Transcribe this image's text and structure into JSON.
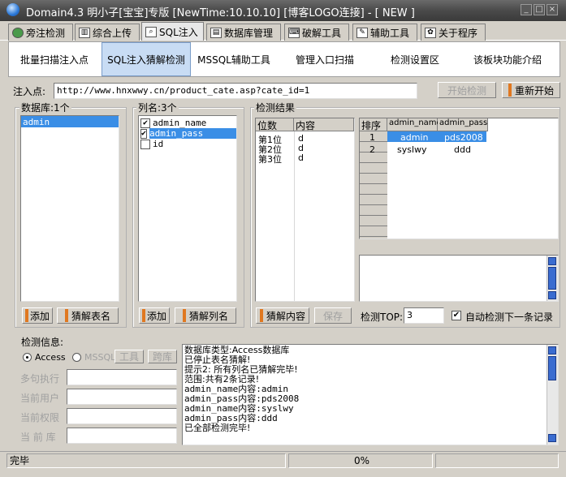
{
  "window": {
    "title": "Domain4.3 明小子[宝宝]专版 [NewTime:10.10.10] [博客LOGO连接]  - [ NEW ]",
    "controls": [
      "_",
      "□",
      "×"
    ]
  },
  "tabs": [
    {
      "label": "旁注检测",
      "icon": "globe-icon",
      "active": false
    },
    {
      "label": "综合上传",
      "icon": "chart-icon",
      "active": false
    },
    {
      "label": "SQL注入",
      "icon": "magnifier-icon",
      "active": true
    },
    {
      "label": "数据库管理",
      "icon": "database-icon",
      "active": false
    },
    {
      "label": "破解工具",
      "icon": "keyboard-icon",
      "active": false
    },
    {
      "label": "辅助工具",
      "icon": "pencil-icon",
      "active": false
    },
    {
      "label": "关于程序",
      "icon": "gift-icon",
      "active": false
    }
  ],
  "subtabs": [
    {
      "label": "批量扫描注入点",
      "active": false
    },
    {
      "label": "SQL注入猜解检测",
      "active": true
    },
    {
      "label": "MSSQL辅助工具",
      "active": false
    },
    {
      "label": "管理入口扫描",
      "active": false
    },
    {
      "label": "检测设置区",
      "active": false
    },
    {
      "label": "该板块功能介绍",
      "active": false
    }
  ],
  "inject": {
    "label": "注入点:",
    "url": "http://www.hnxwwy.cn/product_cate.asp?cate_id=1",
    "start_button": "开始检测",
    "restart_button": "重新开始"
  },
  "database": {
    "label": "数据库:1个",
    "items": [
      "admin"
    ],
    "add_button": "添加",
    "guess_button": "猜解表名"
  },
  "columns": {
    "label": "列名:3个",
    "items": [
      {
        "name": "admin_name",
        "checked": true,
        "selected": false
      },
      {
        "name": "admin_pass",
        "checked": true,
        "selected": true
      },
      {
        "name": "id",
        "checked": false,
        "selected": false
      }
    ],
    "add_button": "添加",
    "guess_button": "猜解列名"
  },
  "result": {
    "label": "检测结果",
    "pos_headers": [
      "位数",
      "内容"
    ],
    "pos_rows": [
      [
        "第1位",
        "d"
      ],
      [
        "第2位",
        "d"
      ],
      [
        "第3位",
        "d"
      ]
    ],
    "data_headers": [
      "排序",
      "admin_name",
      "admin_pass"
    ],
    "data_rows": [
      [
        "1",
        "admin",
        "pds2008"
      ],
      [
        "2",
        "syslwy",
        "ddd"
      ]
    ],
    "guess_content_button": "猜解内容",
    "save_button": "保存",
    "top_label": "检测TOP:",
    "top_value": "3",
    "auto_label": "自动检测下一条记录",
    "auto_checked": true
  },
  "info": {
    "label": "检测信息:",
    "radio_access": "Access",
    "radio_mssql": "MSSQL",
    "tool_button": "工具",
    "cross_button": "跨库",
    "fields": [
      {
        "label": "多句执行",
        "value": ""
      },
      {
        "label": "当前用户",
        "value": ""
      },
      {
        "label": "当前权限",
        "value": ""
      },
      {
        "label": "当 前 库",
        "value": ""
      }
    ],
    "log": [
      "数据库类型:Access数据库",
      "已停止表名猜解!",
      "提示2: 所有列名已猜解完毕!",
      "范围:共有2条记录!",
      "admin_name内容:admin",
      "admin_pass内容:pds2008",
      "admin_name内容:syslwy",
      "admin_pass内容:ddd",
      "已全部检测完毕!"
    ]
  },
  "status": {
    "text": "完毕",
    "progress": "0%"
  }
}
